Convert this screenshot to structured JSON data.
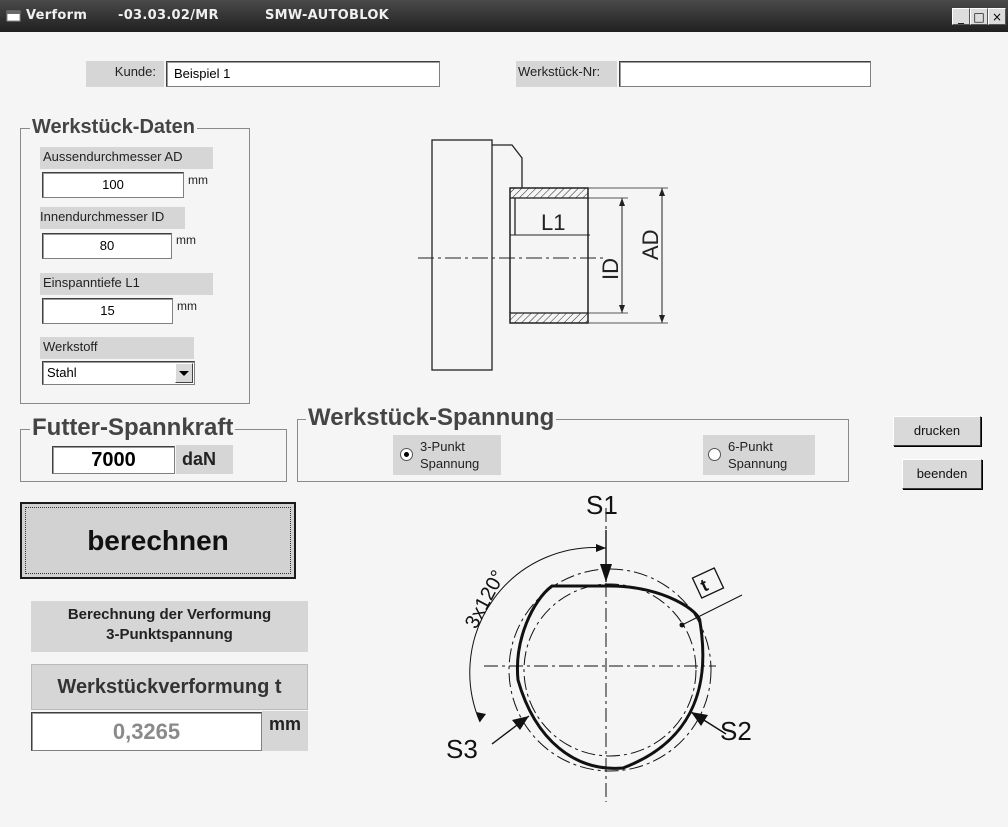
{
  "window": {
    "title_app": "Verform",
    "title_version": "-03.03.02/MR",
    "title_company": "SMW-AUTOBLOK",
    "minimize": "_",
    "maximize": "□",
    "close": "×"
  },
  "header": {
    "kunde_label": "Kunde:",
    "kunde_value": "Beispiel 1",
    "werkstueck_nr_label": "Werkstück-Nr:",
    "werkstueck_nr_value": ""
  },
  "werkstueck_daten": {
    "title": "Werkstück-Daten",
    "ad_label": "Aussendurchmesser AD",
    "ad_value": "100",
    "ad_unit": "mm",
    "id_label": "Innendurchmesser ID",
    "id_value": "80",
    "id_unit": "mm",
    "l1_label": "Einspanntiefe L1",
    "l1_value": "15",
    "l1_unit": "mm",
    "werkstoff_label": "Werkstoff",
    "werkstoff_value": "Stahl"
  },
  "drawing1": {
    "l1": "L1",
    "id": "ID",
    "ad": "AD"
  },
  "futter": {
    "title": "Futter-Spannkraft",
    "value": "7000",
    "unit": "daN"
  },
  "spannung": {
    "title": "Werkstück-Spannung",
    "option1_line1": "3-Punkt",
    "option1_line2": "Spannung",
    "option1_selected": true,
    "option2_line1": "6-Punkt",
    "option2_line2": "Spannung",
    "option2_selected": false
  },
  "buttons": {
    "drucken": "drucken",
    "beenden": "beenden",
    "berechnen": "berechnen"
  },
  "result": {
    "info_line1": "Berechnung der Verformung",
    "info_line2": "3-Punktspannung",
    "title": "Werkstückverformung t",
    "value": "0,3265",
    "unit": "mm"
  },
  "drawing2": {
    "s1": "S1",
    "s2": "S2",
    "s3": "S3",
    "angle": "3x120°",
    "t": "t"
  }
}
